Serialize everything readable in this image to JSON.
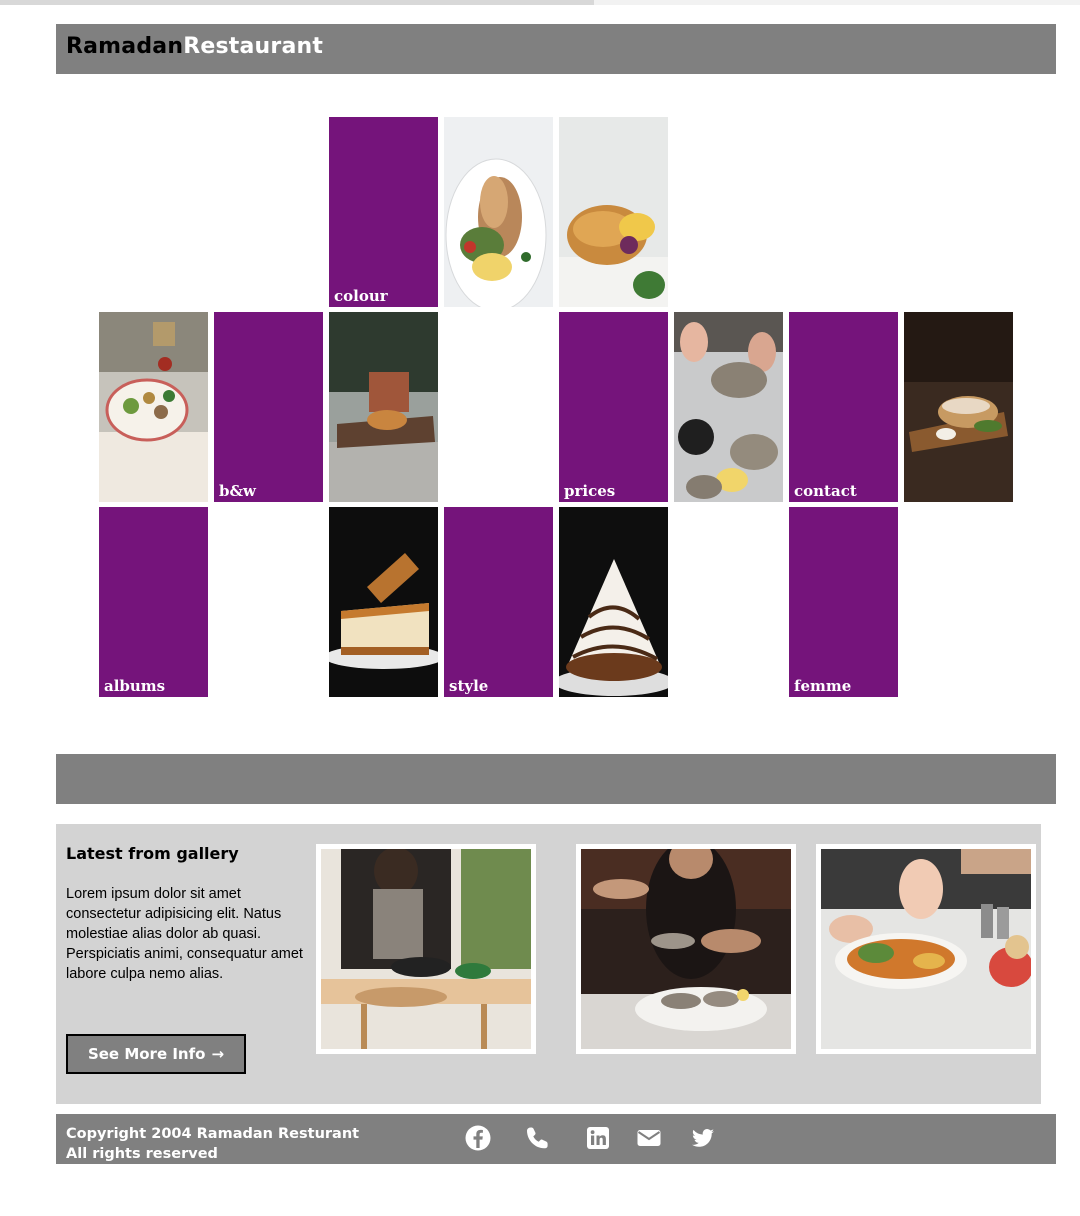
{
  "header": {
    "brand_part1": "Ramadan",
    "brand_part2": "Restaurant"
  },
  "tiles": {
    "colour": "colour",
    "bw": "b&w",
    "prices": "prices",
    "contact": "contact",
    "albums": "albums",
    "style": "style",
    "femme": "femme"
  },
  "gallery": {
    "title": "Latest from gallery",
    "text": "Lorem ipsum dolor sit amet consectetur adipisicing elit. Natus molestiae alias dolor ab quasi. Perspiciatis animi, consequatur amet labore culpa nemo alias.",
    "button_label": "See More Info",
    "button_arrow": "→"
  },
  "footer": {
    "copyright_line1": "Copyright 2004 Ramadan Resturant",
    "copyright_line2": "All rights reserved",
    "social_icons": [
      "facebook-icon",
      "phone-icon",
      "linkedin-icon",
      "email-icon",
      "twitter-icon"
    ]
  },
  "colors": {
    "accent_purple": "#75147b",
    "bar_gray": "#808080",
    "panel_gray": "#d3d3d3"
  }
}
